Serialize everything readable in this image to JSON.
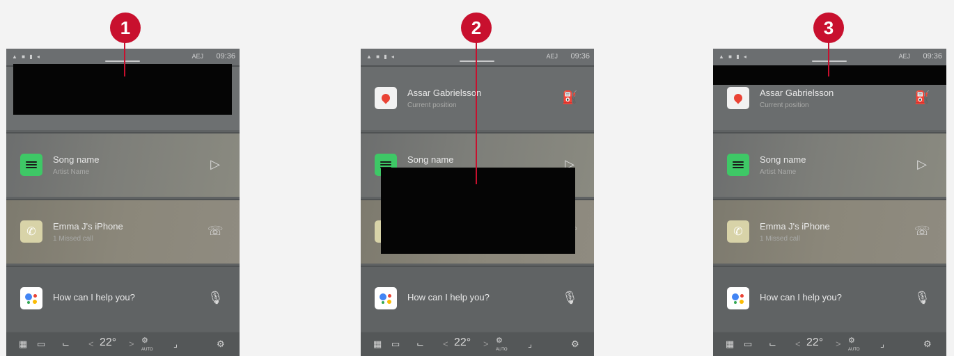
{
  "callouts": [
    "1",
    "2",
    "3"
  ],
  "status": {
    "signal": "▲ ■ ▮ ◂",
    "network": "AEJ",
    "time": "09:36"
  },
  "tiles": {
    "map": {
      "title": "Assar Gabrielsson",
      "subtitle": "Current position",
      "action_icon": "fuel-pump-icon",
      "app_icon": "google-maps-icon"
    },
    "music": {
      "title": "Song name",
      "subtitle": "Artist Name",
      "action_icon": "play-icon",
      "app_icon": "spotify-icon"
    },
    "phone": {
      "title": "Emma J's iPhone",
      "subtitle": "1 Missed call",
      "action_icon": "phone-hangup-icon",
      "app_icon": "phone-icon"
    },
    "assistant": {
      "title": "How can I help you?",
      "action_icon": "microphone-icon",
      "app_icon": "google-assistant-icon"
    }
  },
  "climate": {
    "temperature": "22°",
    "fan_label": "AUTO",
    "left_arrow": "<",
    "right_arrow": ">"
  },
  "colors": {
    "callout": "#c8102e",
    "spotify_green": "#3ec866",
    "redaction": "#050505"
  }
}
